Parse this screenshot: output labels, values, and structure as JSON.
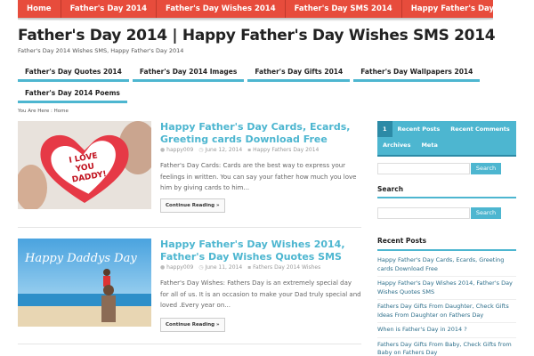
{
  "topnav": {
    "items": [
      "Home",
      "Father's Day 2014",
      "Father's Day Wishes 2014",
      "Father's Day SMS 2014",
      "Happy Father's Day Wishes"
    ]
  },
  "header": {
    "title": "Father's Day 2014 | Happy Father's Day Wishes SMS 2014",
    "description": "Father's Day 2014 Wishes SMS, Happy Father's Day 2014"
  },
  "secnav": {
    "row1": [
      "Father's Day Quotes 2014",
      "Father's Day 2014 Images",
      "Father's Day Gifts 2014",
      "Father's Day Wallpapers 2014"
    ],
    "row2": [
      "Father's Day 2014 Poems"
    ]
  },
  "breadcrumb": "You Are Here : Home",
  "posts": [
    {
      "title": "Happy Father's Day Cards, Ecards, Greeting cards Download Free",
      "author": "happy009",
      "date": "June 12, 2014",
      "category": "Happy Fathers Day 2014",
      "excerpt": "Father's Day Cards: Cards are the best way to express your feelings in written. You can say your father how much you love him by giving cards to him...",
      "readmore": "Continue Reading »",
      "thumb_text": [
        "I LOVE",
        "YOU",
        "DADDY!"
      ]
    },
    {
      "title": "Happy Father's Day Wishes 2014, Father's Day Wishes Quotes SMS",
      "author": "happy009",
      "date": "June 11, 2014",
      "category": "Fathers Day 2014 Wishes",
      "excerpt": "Father's Day Wishes: Fathers Day is an extremely special day for all of us. It is an occasion to make your Dad truly special and loved .Every year on...",
      "readmore": "Continue Reading »",
      "thumb_text": [
        "Happy Daddys Day"
      ]
    }
  ],
  "sidebar": {
    "tabs": {
      "active": "1",
      "row1": [
        "Recent Posts",
        "Recent Comments"
      ],
      "row2": [
        "Archives",
        "Meta"
      ]
    },
    "search_button": "Search",
    "search_title": "Search",
    "recent_title": "Recent Posts",
    "recent_posts": [
      "Happy Father's Day Cards, Ecards, Greeting cards Download Free",
      "Happy Father's Day Wishes 2014, Father's Day Wishes Quotes SMS",
      "Fathers Day Gifts From Daughter, Check Gifts Ideas From Daughter on Fathers Day",
      "When is Father's Day in 2014 ?",
      "Fathers Day Gifts From Baby, Check Gifts from Baby on Fathers Day"
    ]
  },
  "colors": {
    "topnav_bg": "#e74c3c",
    "accent": "#4db6d0",
    "accent_dark": "#2c8aa6"
  }
}
